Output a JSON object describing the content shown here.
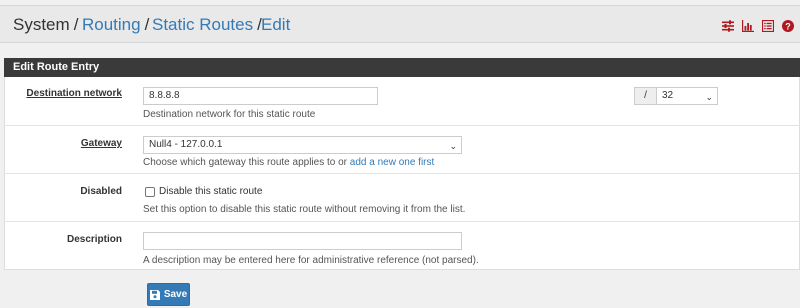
{
  "breadcrumb": {
    "items": [
      {
        "label": "System"
      },
      {
        "label": "Routing"
      },
      {
        "label": "Static Routes"
      },
      {
        "label": "Edit"
      }
    ],
    "separator": "/",
    "icons": [
      "settings-sliders-icon",
      "chart-icon",
      "list-icon",
      "help-icon"
    ]
  },
  "panel": {
    "title": "Edit Route Entry"
  },
  "form": {
    "destination": {
      "label": "Destination network",
      "value": "8.8.8.8",
      "help": "Destination network for this static route",
      "slash": "/",
      "mask_value": "32"
    },
    "gateway": {
      "label": "Gateway",
      "value": "Null4 - 127.0.0.1",
      "help_prefix": "Choose which gateway this route applies to or ",
      "help_link": "add a new one first"
    },
    "disabled": {
      "label": "Disabled",
      "checkbox_label": "Disable this static route",
      "checked": false,
      "help": "Set this option to disable this static route without removing it from the list."
    },
    "description": {
      "label": "Description",
      "value": "",
      "help": "A description may be entered here for administrative reference (not parsed)."
    }
  },
  "actions": {
    "save_label": "Save"
  },
  "colors": {
    "link": "#337ab7",
    "panel_heading": "#3a3a3a",
    "icon_red": "#b0171f"
  }
}
